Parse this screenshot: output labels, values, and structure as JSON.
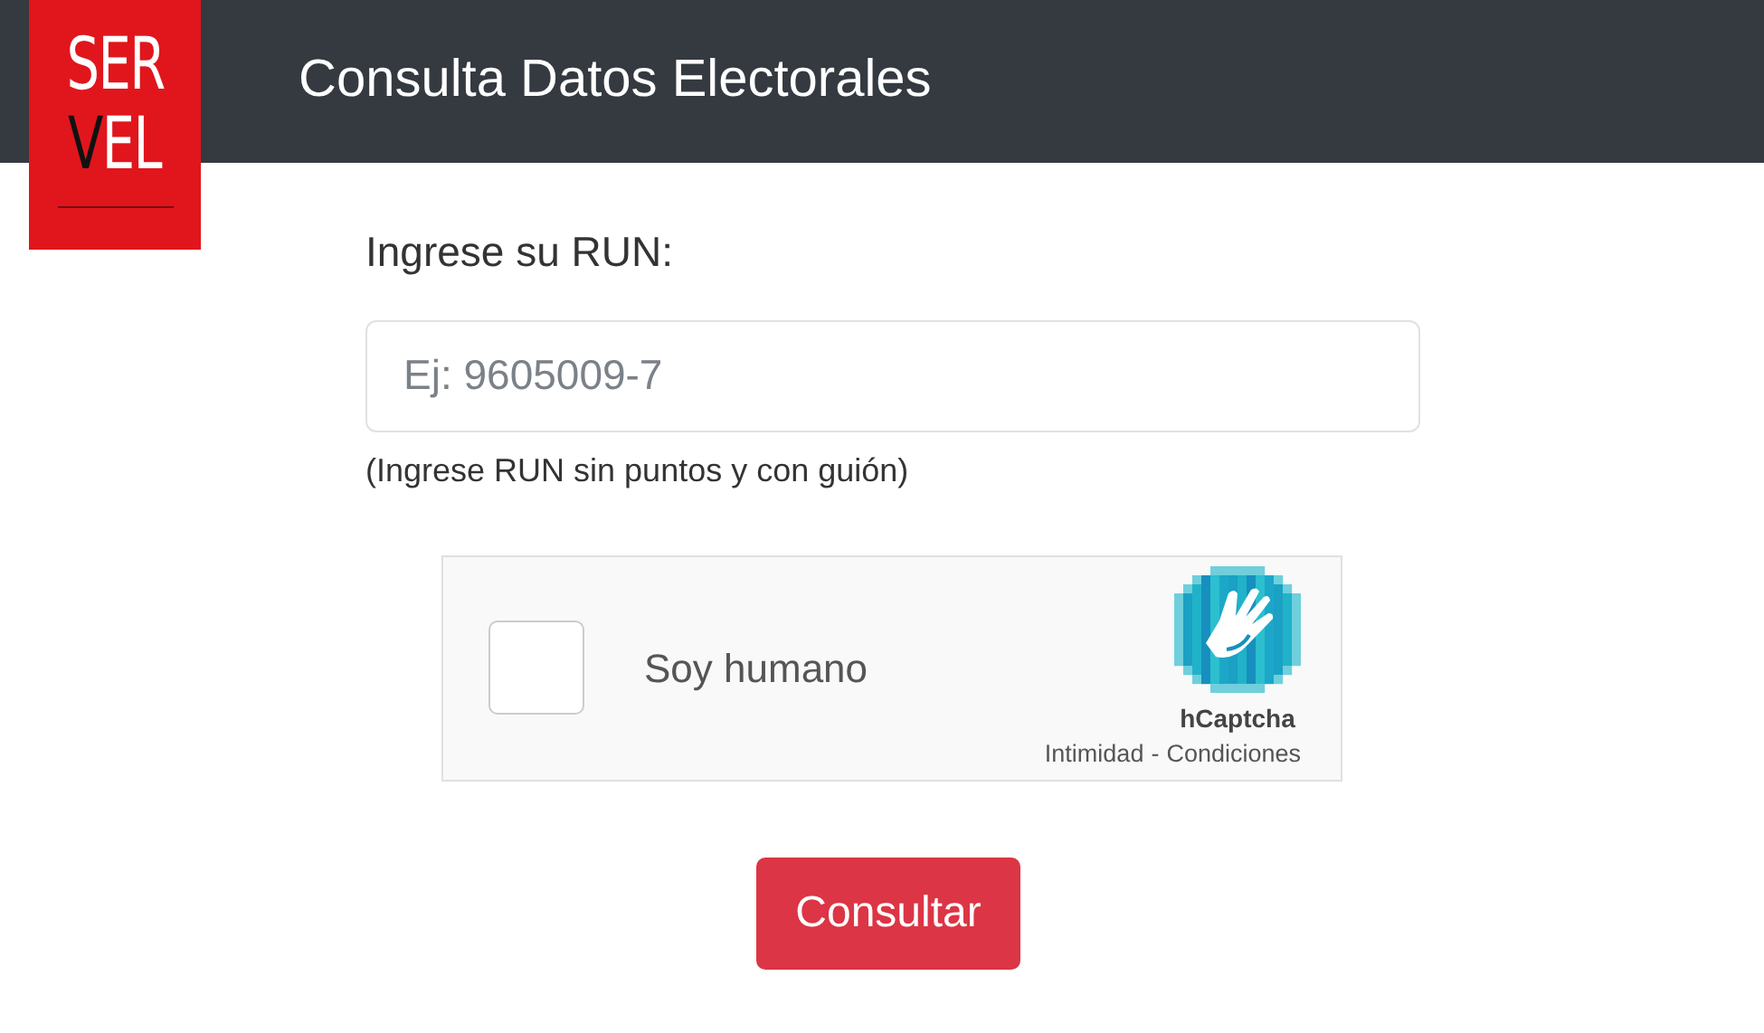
{
  "logo": {
    "top": "SER",
    "bottom_mark": "V",
    "bottom_rest": "EL"
  },
  "header": {
    "title": "Consulta Datos Electorales"
  },
  "form": {
    "label": "Ingrese su RUN:",
    "placeholder": "Ej: 9605009-7",
    "help": "(Ingrese RUN sin puntos y con guión)"
  },
  "captcha": {
    "checked": false,
    "label": "Soy humano",
    "brand": "hCaptcha",
    "privacy_link": "Intimidad",
    "separator": "-",
    "terms_link": "Condiciones"
  },
  "submit": {
    "label": "Consultar"
  }
}
